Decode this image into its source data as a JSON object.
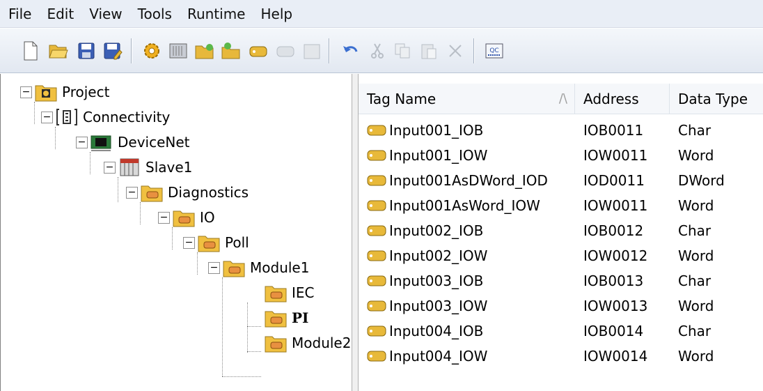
{
  "menu": [
    "File",
    "Edit",
    "View",
    "Tools",
    "Runtime",
    "Help"
  ],
  "toolbar": {
    "icons": [
      "new-file-icon",
      "open-folder-icon",
      "save-icon",
      "save-as-icon",
      "gear-icon",
      "device-icon",
      "new-folder-icon",
      "add-item-icon",
      "tag-icon",
      "disabled-icon",
      "disabled-icon",
      "undo-icon",
      "cut-icon",
      "copy-icon",
      "paste-icon",
      "delete-icon",
      "quick-client-icon"
    ],
    "qc_label": "QC"
  },
  "tree": [
    {
      "label": "Project",
      "icon": "project-icon",
      "expander": "−"
    },
    {
      "label": "Connectivity",
      "icon": "connectivity-icon",
      "expander": "−"
    },
    {
      "label": "DeviceNet",
      "icon": "channel-icon",
      "expander": "−"
    },
    {
      "label": "Slave1",
      "icon": "device-icon",
      "expander": "−"
    },
    {
      "label": "Diagnostics",
      "icon": "folder-icon",
      "expander": "−"
    },
    {
      "label": "IO",
      "icon": "folder-icon",
      "expander": "−"
    },
    {
      "label": "Poll",
      "icon": "folder-icon",
      "expander": "−"
    },
    {
      "label": "Module1",
      "icon": "folder-icon",
      "expander": "−"
    },
    {
      "label": "IEC",
      "icon": "folder-icon",
      "expander": ""
    },
    {
      "label": "PI",
      "icon": "folder-icon",
      "expander": "",
      "selected": true
    },
    {
      "label": "Module2",
      "icon": "folder-icon",
      "expander": ""
    }
  ],
  "table": {
    "columns": [
      "Tag Name",
      "Address",
      "Data Type"
    ],
    "rows": [
      [
        "Input001_IOB",
        "IOB0011",
        "Char"
      ],
      [
        "Input001_IOW",
        "IOW0011",
        "Word"
      ],
      [
        "Input001AsDWord_IOD",
        "IOD0011",
        "DWord"
      ],
      [
        "Input001AsWord_IOW",
        "IOW0011",
        "Word"
      ],
      [
        "Input002_IOB",
        "IOB0012",
        "Char"
      ],
      [
        "Input002_IOW",
        "IOW0012",
        "Word"
      ],
      [
        "Input003_IOB",
        "IOB0013",
        "Char"
      ],
      [
        "Input003_IOW",
        "IOW0013",
        "Word"
      ],
      [
        "Input004_IOB",
        "IOB0014",
        "Char"
      ],
      [
        "Input004_IOW",
        "IOW0014",
        "Word"
      ]
    ]
  },
  "colors": {
    "folder": "#f0c040",
    "tag": "#e8b93a",
    "menubar": "#e9eef6"
  }
}
